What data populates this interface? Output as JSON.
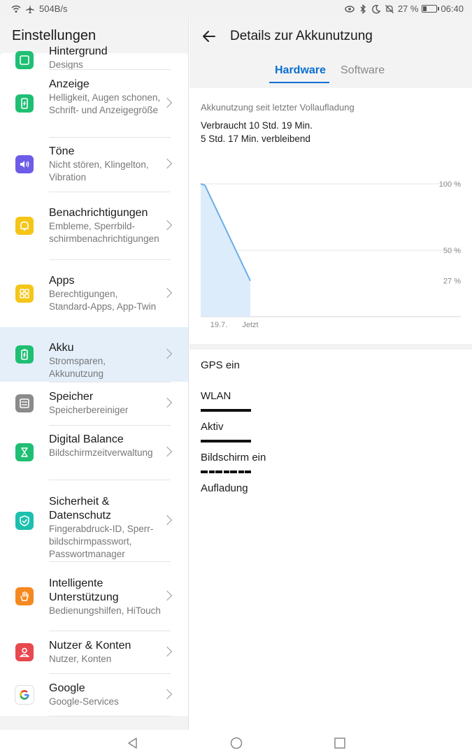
{
  "status_bar": {
    "net_speed": "504B/s",
    "battery_percent": "27 %",
    "battery_level": 0.27,
    "time": "06:40"
  },
  "left_panel": {
    "title": "Einstellungen",
    "items": [
      {
        "title": "Hintergrund",
        "subtitle": "Designs",
        "color": "#1fbf73",
        "icon": "wallpaper-icon"
      },
      {
        "title": "Anzeige",
        "subtitle": "Helligkeit, Augen schonen, Schrift- und Anzeigegröße",
        "color": "#1fbf73",
        "icon": "display-icon"
      },
      {
        "title": "Töne",
        "subtitle": "Nicht stören, Klingelton, Vibration",
        "color": "#6d5ce8",
        "icon": "sound-icon"
      },
      {
        "title": "Benachrichtigungen",
        "subtitle": "Embleme, Sperrbild­schirmbenachrichtigun­gen",
        "color": "#f5c518",
        "icon": "bell-icon"
      },
      {
        "title": "Apps",
        "subtitle": "Berechtigungen, Standard-Apps, App-Twin",
        "color": "#f5c518",
        "icon": "apps-icon"
      },
      {
        "title": "Akku",
        "subtitle": "Stromsparen, Akkunutzung",
        "color": "#1fbf73",
        "icon": "battery-icon"
      },
      {
        "title": "Speicher",
        "subtitle": "Speicherbereiniger",
        "color": "#8a8a8a",
        "icon": "storage-icon"
      },
      {
        "title": "Digital Balance",
        "subtitle": "Bildschirmzeitverwal­tung",
        "color": "#1fbf73",
        "icon": "hourglass-icon"
      },
      {
        "title": "Sicherheit & Datenschutz",
        "subtitle": "Fingerabdruck-ID, Sperr­bildschirmpasswort, Passwortmanager",
        "color": "#1dbfae",
        "icon": "shield-icon"
      },
      {
        "title": "Intelligente Unterstützung",
        "subtitle": "Bedienungshilfen, HiTouch",
        "color": "#f5891f",
        "icon": "hand-icon"
      },
      {
        "title": "Nutzer & Konten",
        "subtitle": "Nutzer, Konten",
        "color": "#e8484f",
        "icon": "user-icon"
      },
      {
        "title": "Google",
        "subtitle": "Google-Services",
        "color": "#ffffff",
        "icon": "google-icon"
      }
    ]
  },
  "right_panel": {
    "title": "Details zur Akkunutzung",
    "tabs": [
      "Hardware",
      "Software"
    ],
    "since_label": "Akkunutzung seit letzter Vollaufladung",
    "used": "Verbraucht 10 Std. 19 Min.",
    "remaining": "5 Std. 17 Min. verbleibend",
    "usage_rows": [
      {
        "label": "GPS ein",
        "fraction": 0
      },
      {
        "label": "WLAN",
        "fraction": 1
      },
      {
        "label": "Aktiv",
        "fraction": 1
      },
      {
        "label": "Bildschirm ein",
        "fraction": 1
      },
      {
        "label": "Aufladung",
        "fraction": 0
      }
    ]
  },
  "chart_data": {
    "type": "area",
    "x_tick_labels": [
      "19.7.",
      "Jetzt"
    ],
    "y_tick_labels": [
      "100 %",
      "50 %",
      "27 %"
    ],
    "series": [
      {
        "values": [
          100,
          99,
          27
        ]
      }
    ],
    "ylim": [
      0,
      100
    ],
    "accent_color": "#6aaee8"
  }
}
